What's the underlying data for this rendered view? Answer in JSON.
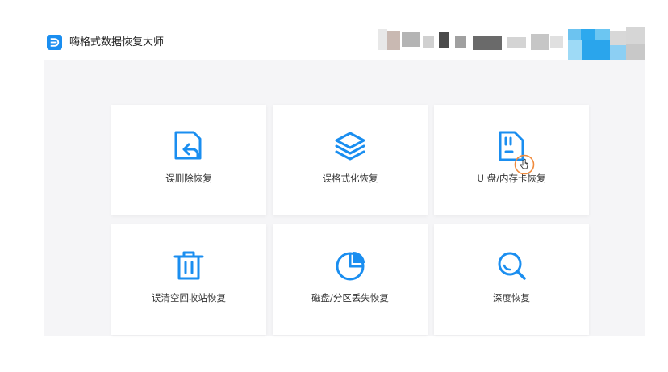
{
  "app": {
    "title": "嗨格式数据恢复大师",
    "accent_color": "#1a8ef0"
  },
  "recovery_options": [
    {
      "label": "误删除恢复",
      "icon": "deleted-file-restore-icon"
    },
    {
      "label": "误格式化恢复",
      "icon": "layers-icon"
    },
    {
      "label": "U 盘/内存卡恢复",
      "icon": "sd-card-icon"
    },
    {
      "label": "误清空回收站恢复",
      "icon": "trash-icon"
    },
    {
      "label": "磁盘/分区丢失恢复",
      "icon": "pie-chart-icon"
    },
    {
      "label": "深度恢复",
      "icon": "magnifier-icon"
    }
  ]
}
